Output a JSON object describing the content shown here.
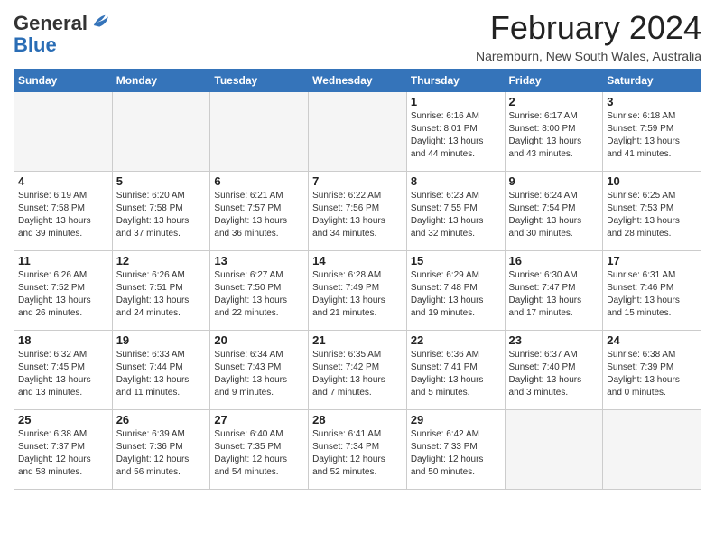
{
  "header": {
    "logo_line1": "General",
    "logo_line2": "Blue",
    "month_title": "February 2024",
    "location": "Naremburn, New South Wales, Australia"
  },
  "days_of_week": [
    "Sunday",
    "Monday",
    "Tuesday",
    "Wednesday",
    "Thursday",
    "Friday",
    "Saturday"
  ],
  "weeks": [
    [
      {
        "day": "",
        "info": ""
      },
      {
        "day": "",
        "info": ""
      },
      {
        "day": "",
        "info": ""
      },
      {
        "day": "",
        "info": ""
      },
      {
        "day": "1",
        "info": "Sunrise: 6:16 AM\nSunset: 8:01 PM\nDaylight: 13 hours\nand 44 minutes."
      },
      {
        "day": "2",
        "info": "Sunrise: 6:17 AM\nSunset: 8:00 PM\nDaylight: 13 hours\nand 43 minutes."
      },
      {
        "day": "3",
        "info": "Sunrise: 6:18 AM\nSunset: 7:59 PM\nDaylight: 13 hours\nand 41 minutes."
      }
    ],
    [
      {
        "day": "4",
        "info": "Sunrise: 6:19 AM\nSunset: 7:58 PM\nDaylight: 13 hours\nand 39 minutes."
      },
      {
        "day": "5",
        "info": "Sunrise: 6:20 AM\nSunset: 7:58 PM\nDaylight: 13 hours\nand 37 minutes."
      },
      {
        "day": "6",
        "info": "Sunrise: 6:21 AM\nSunset: 7:57 PM\nDaylight: 13 hours\nand 36 minutes."
      },
      {
        "day": "7",
        "info": "Sunrise: 6:22 AM\nSunset: 7:56 PM\nDaylight: 13 hours\nand 34 minutes."
      },
      {
        "day": "8",
        "info": "Sunrise: 6:23 AM\nSunset: 7:55 PM\nDaylight: 13 hours\nand 32 minutes."
      },
      {
        "day": "9",
        "info": "Sunrise: 6:24 AM\nSunset: 7:54 PM\nDaylight: 13 hours\nand 30 minutes."
      },
      {
        "day": "10",
        "info": "Sunrise: 6:25 AM\nSunset: 7:53 PM\nDaylight: 13 hours\nand 28 minutes."
      }
    ],
    [
      {
        "day": "11",
        "info": "Sunrise: 6:26 AM\nSunset: 7:52 PM\nDaylight: 13 hours\nand 26 minutes."
      },
      {
        "day": "12",
        "info": "Sunrise: 6:26 AM\nSunset: 7:51 PM\nDaylight: 13 hours\nand 24 minutes."
      },
      {
        "day": "13",
        "info": "Sunrise: 6:27 AM\nSunset: 7:50 PM\nDaylight: 13 hours\nand 22 minutes."
      },
      {
        "day": "14",
        "info": "Sunrise: 6:28 AM\nSunset: 7:49 PM\nDaylight: 13 hours\nand 21 minutes."
      },
      {
        "day": "15",
        "info": "Sunrise: 6:29 AM\nSunset: 7:48 PM\nDaylight: 13 hours\nand 19 minutes."
      },
      {
        "day": "16",
        "info": "Sunrise: 6:30 AM\nSunset: 7:47 PM\nDaylight: 13 hours\nand 17 minutes."
      },
      {
        "day": "17",
        "info": "Sunrise: 6:31 AM\nSunset: 7:46 PM\nDaylight: 13 hours\nand 15 minutes."
      }
    ],
    [
      {
        "day": "18",
        "info": "Sunrise: 6:32 AM\nSunset: 7:45 PM\nDaylight: 13 hours\nand 13 minutes."
      },
      {
        "day": "19",
        "info": "Sunrise: 6:33 AM\nSunset: 7:44 PM\nDaylight: 13 hours\nand 11 minutes."
      },
      {
        "day": "20",
        "info": "Sunrise: 6:34 AM\nSunset: 7:43 PM\nDaylight: 13 hours\nand 9 minutes."
      },
      {
        "day": "21",
        "info": "Sunrise: 6:35 AM\nSunset: 7:42 PM\nDaylight: 13 hours\nand 7 minutes."
      },
      {
        "day": "22",
        "info": "Sunrise: 6:36 AM\nSunset: 7:41 PM\nDaylight: 13 hours\nand 5 minutes."
      },
      {
        "day": "23",
        "info": "Sunrise: 6:37 AM\nSunset: 7:40 PM\nDaylight: 13 hours\nand 3 minutes."
      },
      {
        "day": "24",
        "info": "Sunrise: 6:38 AM\nSunset: 7:39 PM\nDaylight: 13 hours\nand 0 minutes."
      }
    ],
    [
      {
        "day": "25",
        "info": "Sunrise: 6:38 AM\nSunset: 7:37 PM\nDaylight: 12 hours\nand 58 minutes."
      },
      {
        "day": "26",
        "info": "Sunrise: 6:39 AM\nSunset: 7:36 PM\nDaylight: 12 hours\nand 56 minutes."
      },
      {
        "day": "27",
        "info": "Sunrise: 6:40 AM\nSunset: 7:35 PM\nDaylight: 12 hours\nand 54 minutes."
      },
      {
        "day": "28",
        "info": "Sunrise: 6:41 AM\nSunset: 7:34 PM\nDaylight: 12 hours\nand 52 minutes."
      },
      {
        "day": "29",
        "info": "Sunrise: 6:42 AM\nSunset: 7:33 PM\nDaylight: 12 hours\nand 50 minutes."
      },
      {
        "day": "",
        "info": ""
      },
      {
        "day": "",
        "info": ""
      }
    ]
  ]
}
